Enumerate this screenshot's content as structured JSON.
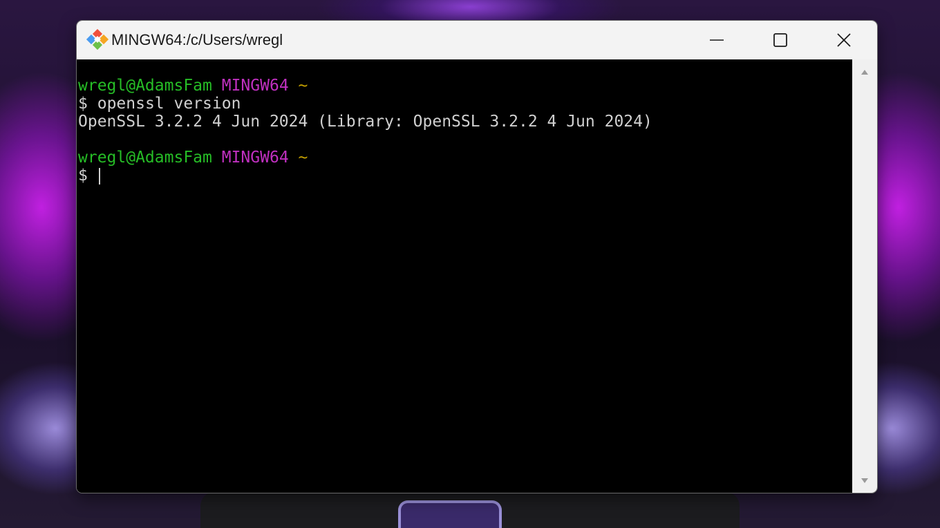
{
  "window": {
    "title": "MINGW64:/c/Users/wregl",
    "icon": "git-bash-icon"
  },
  "controls": {
    "minimize_icon": "minimize-icon",
    "maximize_icon": "maximize-icon",
    "close_icon": "close-icon"
  },
  "terminal": {
    "lines": [
      {
        "user": "wregl@AdamsFam",
        "host": "MINGW64",
        "path": "~"
      },
      {
        "prompt": "$",
        "command": "openssl version"
      },
      {
        "output": "OpenSSL 3.2.2 4 Jun 2024 (Library: OpenSSL 3.2.2 4 Jun 2024)"
      },
      {
        "user": "wregl@AdamsFam",
        "host": "MINGW64",
        "path": "~"
      },
      {
        "prompt": "$",
        "command": ""
      }
    ]
  },
  "colors": {
    "user": "#26bd26",
    "host": "#c030c0",
    "path": "#c4a000",
    "text": "#d0d0d0",
    "background": "#000000"
  }
}
